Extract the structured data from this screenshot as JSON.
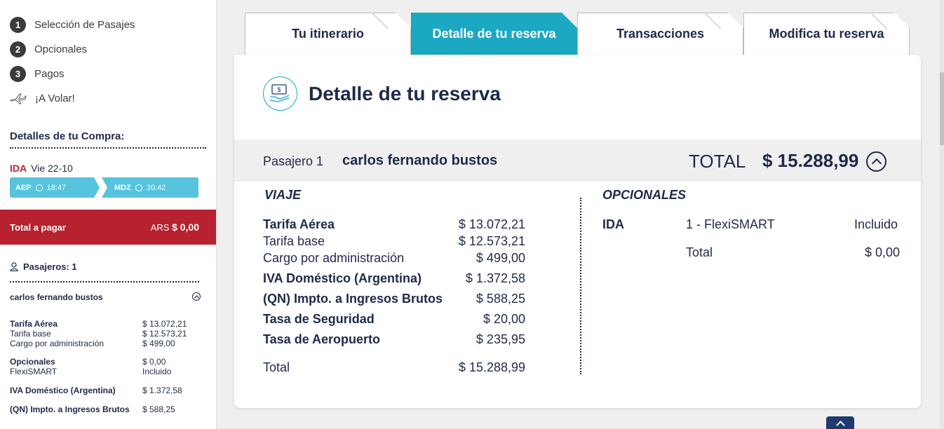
{
  "steps": [
    {
      "num": "1",
      "label": "Selección de Pasajes"
    },
    {
      "num": "2",
      "label": "Opcionales"
    },
    {
      "num": "3",
      "label": "Pagos"
    },
    {
      "label": "¡A Volar!"
    }
  ],
  "compra": {
    "title": "Detalles de tu Compra:",
    "ida_tag": "IDA",
    "ida_date": "Vie 22-10",
    "origin_code": "AEP",
    "origin_time": "18:47",
    "dest_code": "MDZ",
    "dest_time": "20:42"
  },
  "total_pagar": {
    "label": "Total a pagar",
    "currency": "ARS",
    "amount": "$ 0,00"
  },
  "sidebar_pax": {
    "title": "Pasajeros: 1",
    "name": "carlos fernando bustos",
    "fares": [
      {
        "k": "Tarifa Aérea",
        "v": "$ 13.072,21"
      },
      {
        "k": "Tarifa base",
        "v": "$ 12.573,21"
      },
      {
        "k": "Cargo por administración",
        "v": "$ 499,00"
      },
      {
        "k": "Opcionales",
        "v": "$ 0,00"
      },
      {
        "k": "FlexiSMART",
        "v": "Incluido"
      },
      {
        "k": "IVA Doméstico (Argentina)",
        "v": "$ 1.372,58"
      },
      {
        "k": "(QN) Impto. a Ingresos Brutos",
        "v": "$ 588,25"
      }
    ]
  },
  "tabs": [
    "Tu itinerario",
    "Detalle de tu reserva",
    "Transacciones",
    "Modifica tu reserva"
  ],
  "card": {
    "title": "Detalle de tu reserva",
    "pax_label": "Pasajero 1",
    "pax_name": "carlos fernando bustos",
    "total_label": "TOTAL",
    "total_amount": "$ 15.288,99"
  },
  "viaje": {
    "title": "VIAJE",
    "rows": [
      {
        "k": "Tarifa Aérea",
        "v": "$ 13.072,21"
      },
      {
        "k": "Tarifa base",
        "v": "$ 12.573,21"
      },
      {
        "k": "Cargo por administración",
        "v": "$ 499,00"
      },
      {
        "k": "IVA Doméstico (Argentina)",
        "v": "$ 1.372,58"
      },
      {
        "k": "(QN) Impto. a Ingresos Brutos",
        "v": "$ 588,25"
      },
      {
        "k": "Tasa de Seguridad",
        "v": "$ 20,00"
      },
      {
        "k": "Tasa de Aeropuerto",
        "v": "$ 235,95"
      },
      {
        "k": "Total",
        "v": "$ 15.288,99"
      }
    ]
  },
  "opcionales": {
    "title": "OPCIONALES",
    "leg": "IDA",
    "item": "1 - FlexiSMART",
    "status": "Incluido",
    "total_label": "Total",
    "total_value": "$ 0,00"
  }
}
